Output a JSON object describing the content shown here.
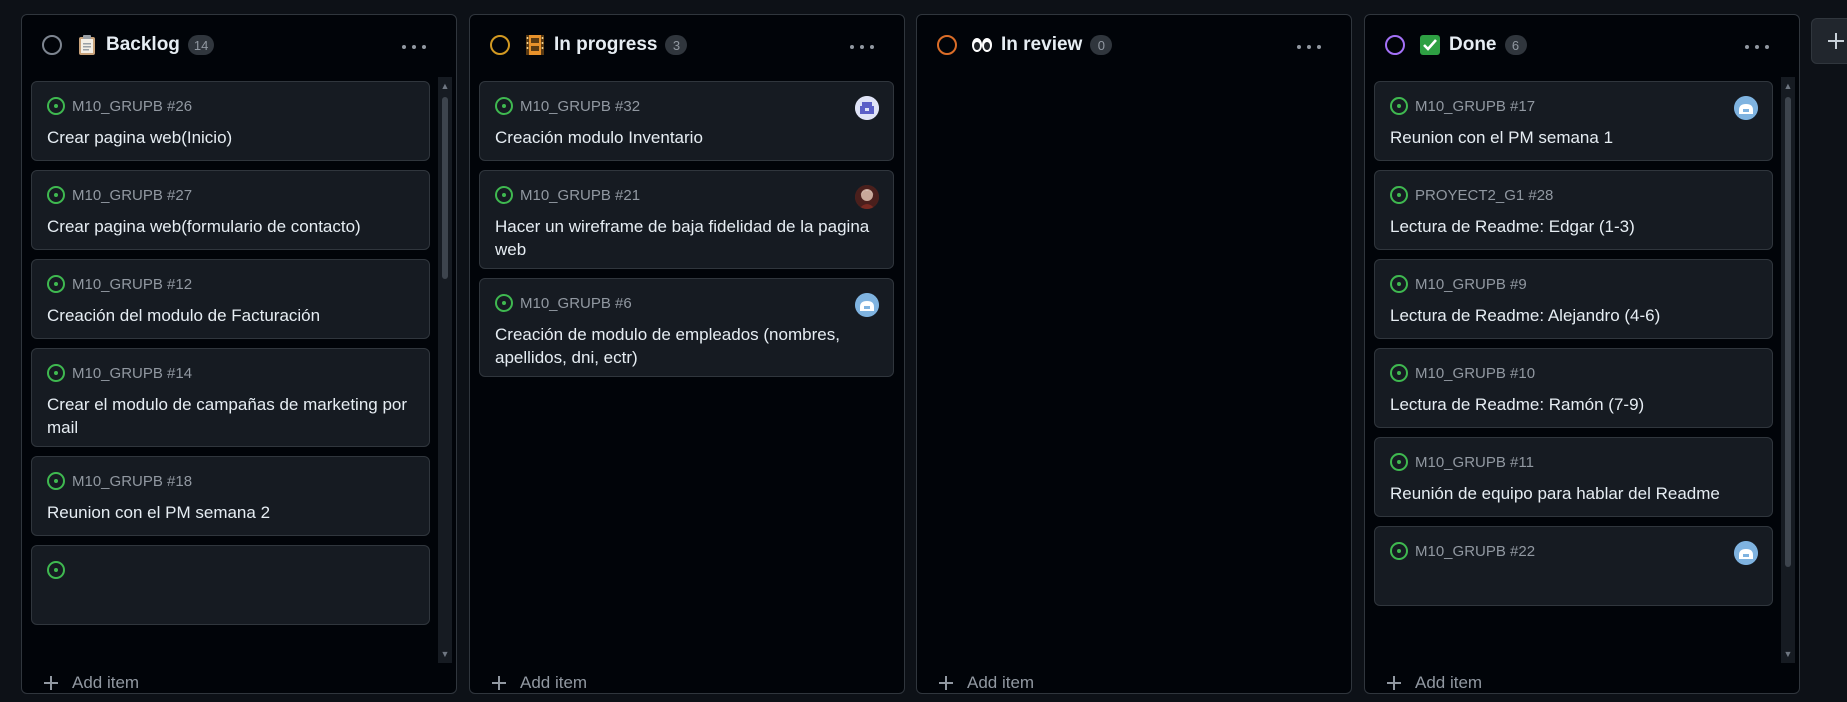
{
  "columns": [
    {
      "title": "Backlog",
      "count": "14",
      "status_color": "#7d8590",
      "emoji": "clipboard-icon",
      "add_label": "Add item",
      "cards": [
        {
          "ref": "M10_GRUPB #26",
          "title": "Crear pagina web(Inicio)"
        },
        {
          "ref": "M10_GRUPB #27",
          "title": "Crear pagina web(formulario de contacto)"
        },
        {
          "ref": "M10_GRUPB #12",
          "title": "Creación del modulo de Facturación"
        },
        {
          "ref": "M10_GRUPB #14",
          "title": "Crear el modulo de campañas de marketing por mail"
        },
        {
          "ref": "M10_GRUPB #18",
          "title": "Reunion con el PM semana 2"
        }
      ]
    },
    {
      "title": "In progress",
      "count": "3",
      "status_color": "#d29922",
      "emoji": "film-frames-icon",
      "add_label": "Add item",
      "cards": [
        {
          "ref": "M10_GRUPB #32",
          "title": "Creación modulo Inventario",
          "avatar": "purple-identicon"
        },
        {
          "ref": "M10_GRUPB #21",
          "title": "Hacer un wireframe de baja fidelidad de la pagina web",
          "avatar": "photo-avatar"
        },
        {
          "ref": "M10_GRUPB #6",
          "title": "Creación de modulo de empleados (nombres, apellidos, dni, ectr)",
          "avatar": "blue-identicon"
        }
      ]
    },
    {
      "title": "In review",
      "count": "0",
      "status_color": "#db6d28",
      "emoji": "eyes-icon",
      "add_label": "Add item",
      "cards": []
    },
    {
      "title": "Done",
      "count": "6",
      "status_color": "#a371f7",
      "emoji": "check-mark-button-icon",
      "add_label": "Add item",
      "cards": [
        {
          "ref": "M10_GRUPB #17",
          "title": "Reunion con el PM semana 1",
          "avatar": "blue-identicon"
        },
        {
          "ref": "PROYECT2_G1 #28",
          "title": "Lectura de Readme: Edgar (1-3)"
        },
        {
          "ref": "M10_GRUPB #9",
          "title": "Lectura de Readme: Alejandro (4-6)"
        },
        {
          "ref": "M10_GRUPB #10",
          "title": "Lectura de Readme: Ramón (7-9)"
        },
        {
          "ref": "M10_GRUPB #11",
          "title": "Reunión de equipo para hablar del Readme"
        },
        {
          "ref": "M10_GRUPB #22",
          "title": "",
          "avatar": "blue-identicon"
        }
      ]
    }
  ],
  "colors": {
    "background": "#0d1117",
    "column_bg": "#010409",
    "card_bg": "#161b22",
    "border": "#30363d",
    "open_issue_green": "#3fb950"
  }
}
